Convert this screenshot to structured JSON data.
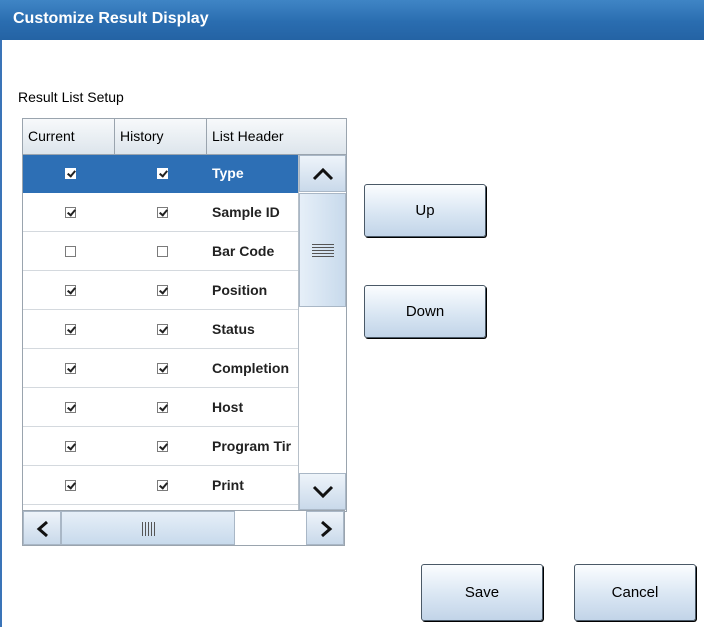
{
  "window": {
    "title": "Customize Result Display"
  },
  "section": {
    "label": "Result List Setup"
  },
  "table": {
    "columns": [
      "Current",
      "History",
      "List Header"
    ],
    "rows": [
      {
        "current": true,
        "history": true,
        "header": "Type",
        "selected": true
      },
      {
        "current": true,
        "history": true,
        "header": "Sample ID",
        "selected": false
      },
      {
        "current": false,
        "history": false,
        "header": "Bar Code",
        "selected": false
      },
      {
        "current": true,
        "history": true,
        "header": "Position",
        "selected": false
      },
      {
        "current": true,
        "history": true,
        "header": "Status",
        "selected": false
      },
      {
        "current": true,
        "history": true,
        "header": "Completion",
        "selected": false
      },
      {
        "current": true,
        "history": true,
        "header": "Host",
        "selected": false
      },
      {
        "current": true,
        "history": true,
        "header": "Program Tir",
        "selected": false
      },
      {
        "current": true,
        "history": true,
        "header": "Print",
        "selected": false
      }
    ]
  },
  "buttons": {
    "up": "Up",
    "down": "Down",
    "save": "Save",
    "cancel": "Cancel"
  },
  "colors": {
    "titlebar": "#2a6db0",
    "selected_row": "#2d6fb5"
  },
  "icons": {
    "scroll_up": "chevron-up-icon",
    "scroll_down": "chevron-down-icon",
    "scroll_left": "chevron-left-icon",
    "scroll_right": "chevron-right-icon"
  }
}
